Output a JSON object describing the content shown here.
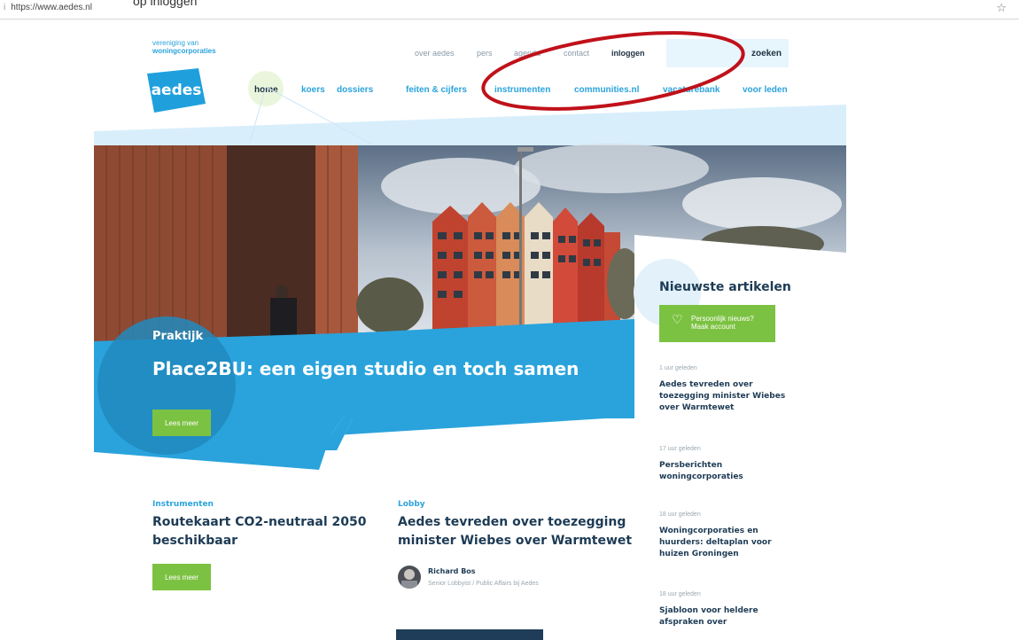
{
  "browser": {
    "top_cut_text": "op inloggen",
    "url_prefix": "i",
    "url": "https://www.aedes.nl",
    "star_icon": "star-icon"
  },
  "header": {
    "tagline_line1": "vereniging van",
    "tagline_line2": "woningcorporaties",
    "logo_text": "aedes",
    "top_links": [
      "over aedes",
      "pers",
      "agenda",
      "contact",
      "inloggen"
    ],
    "search_placeholder": "",
    "search_button": "zoeken",
    "nav": [
      "home",
      "koers",
      "dossiers",
      "feiten & cijfers",
      "instrumenten",
      "communities.nl",
      "vacaturebank",
      "voor leden"
    ]
  },
  "hero": {
    "label": "Praktijk",
    "title": "Place2BU: een eigen studio en toch samen",
    "button": "Lees meer"
  },
  "sidebar": {
    "title": "Nieuwste artikelen",
    "account_line1": "Persoonlijk nieuws?",
    "account_line2": "Maak account",
    "items": [
      {
        "time": "1 uur geleden",
        "lines": [
          "Aedes tevreden over",
          "toezegging minister Wiebes",
          "over Warmtewet"
        ]
      },
      {
        "time": "17 uur geleden",
        "lines": [
          "Persberichten",
          "woningcorporaties"
        ]
      },
      {
        "time": "18 uur geleden",
        "lines": [
          "Woningcorporaties en",
          "huurders: deltaplan voor",
          "huizen Groningen"
        ]
      },
      {
        "time": "18 uur geleden",
        "lines": [
          "Sjabloon voor heldere",
          "afspraken over"
        ]
      }
    ]
  },
  "content": {
    "left": {
      "category": "Instrumenten",
      "title_line1": "Routekaart CO2-neutraal 2050",
      "title_line2": "beschikbaar",
      "button": "Lees meer"
    },
    "right": {
      "category": "Lobby",
      "title_line1": "Aedes tevreden over toezegging",
      "title_line2": "minister Wiebes over Warmtewet",
      "author": "Richard Bos",
      "role": "Senior Lobbyist / Public Affairs bij Aedes"
    }
  },
  "colors": {
    "brand_blue": "#2aa3dc",
    "hero_blue": "#2aa3dc",
    "green": "#7cc242",
    "dark": "#1d3b55",
    "annotation": "#c0111a"
  }
}
